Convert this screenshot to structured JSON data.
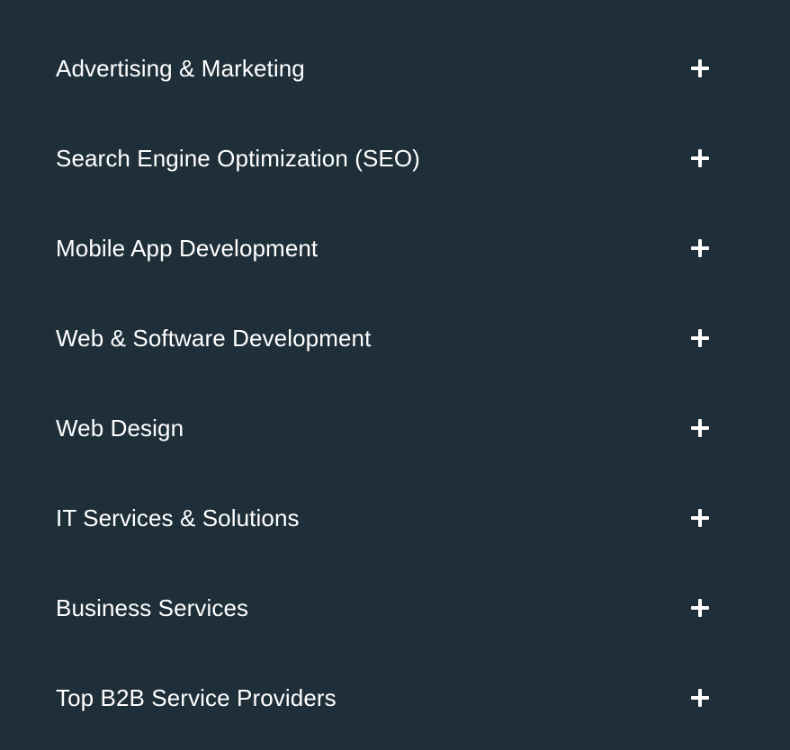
{
  "colors": {
    "background": "#1f2f3a",
    "text": "#ffffff",
    "icon": "#ffffff"
  },
  "accordion": {
    "items": [
      {
        "label": "Advertising & Marketing",
        "icon": "plus-icon"
      },
      {
        "label": "Search Engine Optimization (SEO)",
        "icon": "plus-icon"
      },
      {
        "label": "Mobile App Development",
        "icon": "plus-icon"
      },
      {
        "label": "Web & Software Development",
        "icon": "plus-icon"
      },
      {
        "label": "Web Design",
        "icon": "plus-icon"
      },
      {
        "label": "IT Services & Solutions",
        "icon": "plus-icon"
      },
      {
        "label": "Business Services",
        "icon": "plus-icon"
      },
      {
        "label": "Top B2B Service Providers",
        "icon": "plus-icon"
      }
    ]
  }
}
